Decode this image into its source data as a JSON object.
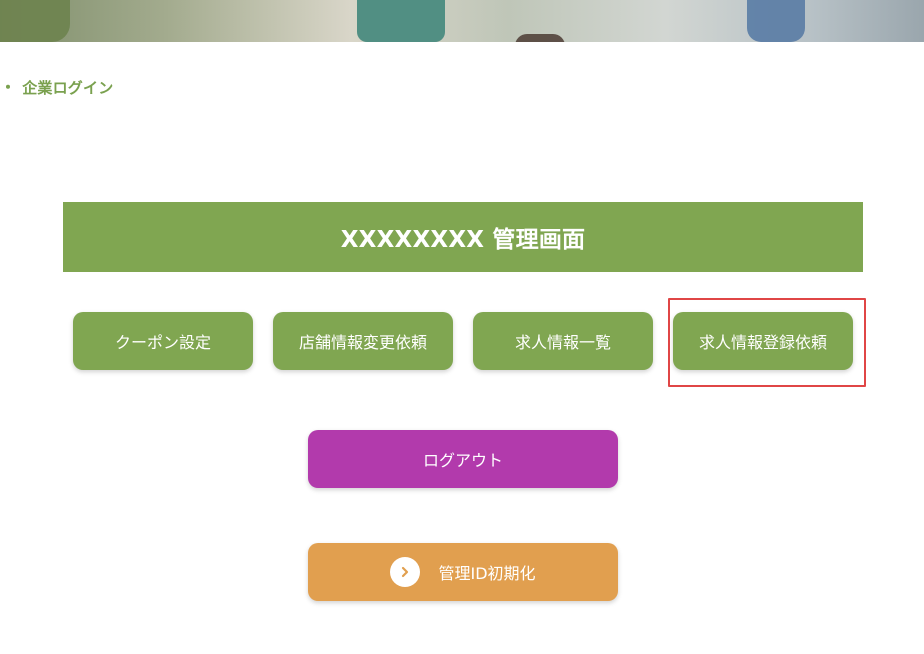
{
  "breadcrumb": {
    "separator": "・",
    "current": "企業ログイン"
  },
  "admin": {
    "title": "XXXXXXXX 管理画面"
  },
  "menu": {
    "buttons": [
      {
        "label": "クーポン設定"
      },
      {
        "label": "店舗情報変更依頼"
      },
      {
        "label": "求人情報一覧"
      },
      {
        "label": "求人情報登録依頼"
      }
    ]
  },
  "logout": {
    "label": "ログアウト"
  },
  "reset_admin_id": {
    "label": "管理ID初期化",
    "icon": "chevron-right-icon"
  },
  "colors": {
    "green": "#80a651",
    "purple": "#b23aac",
    "orange": "#e19f4f",
    "highlight": "#e04646"
  }
}
